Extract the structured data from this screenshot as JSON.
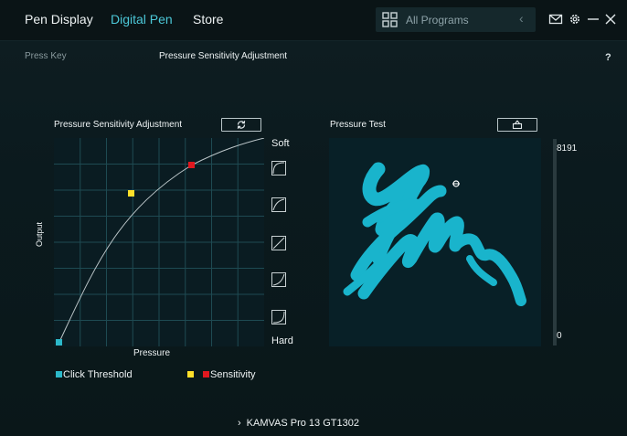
{
  "header": {
    "tabs": [
      {
        "label": "Pen Display",
        "active": false
      },
      {
        "label": "Digital Pen",
        "active": true
      },
      {
        "label": "Store",
        "active": false
      }
    ],
    "search": {
      "placeholder": "All Programs"
    }
  },
  "subtabs": {
    "press_key": "Press Key",
    "pressure": "Pressure Sensitivity Adjustment"
  },
  "help_label": "?",
  "curve_panel": {
    "title": "Pressure Sensitivity Adjustment",
    "y_label": "Output",
    "x_label": "Pressure",
    "soft_label": "Soft",
    "hard_label": "Hard"
  },
  "test_panel": {
    "title": "Pressure Test",
    "max_value": "8191",
    "min_value": "0"
  },
  "legend": {
    "click_threshold": "Click Threshold",
    "sensitivity": "Sensitivity"
  },
  "device": {
    "name": "KAMVAS Pro 13 GT1302"
  },
  "colors": {
    "accent": "#4cc8d8",
    "threshold": "#2cb8c9",
    "sensitivity_yellow": "#ffe02a",
    "sensitivity_red": "#e0181f",
    "stroke": "#19b4cc"
  }
}
